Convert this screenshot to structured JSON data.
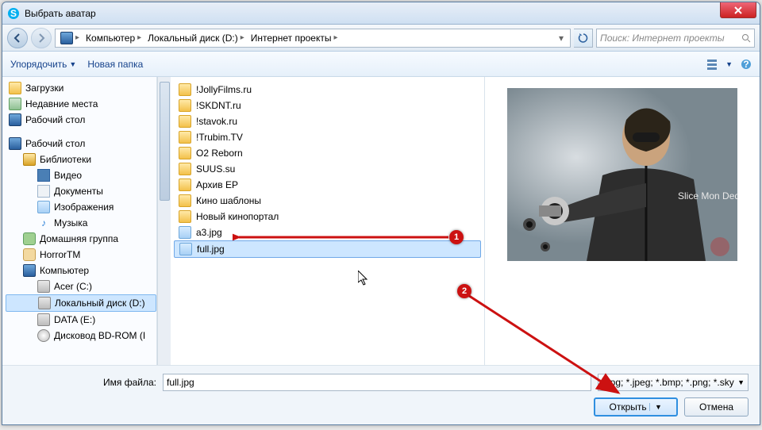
{
  "window": {
    "title": "Выбрать аватар"
  },
  "breadcrumbs": [
    "Компьютер",
    "Локальный диск (D:)",
    "Интернет проекты"
  ],
  "search": {
    "placeholder": "Поиск: Интернет проекты"
  },
  "toolbar": {
    "organize": "Упорядочить",
    "newfolder": "Новая папка"
  },
  "sidebar": {
    "items": [
      {
        "label": "Загрузки",
        "icon": "folder"
      },
      {
        "label": "Недавние места",
        "icon": "recent"
      },
      {
        "label": "Рабочий стол",
        "icon": "monitor"
      },
      {
        "label": "",
        "spacer": true
      },
      {
        "label": "Рабочий стол",
        "icon": "monitor",
        "bold": true
      },
      {
        "label": "Библиотеки",
        "icon": "libraries",
        "indent": 1
      },
      {
        "label": "Видео",
        "icon": "video",
        "indent": 2
      },
      {
        "label": "Документы",
        "icon": "docs",
        "indent": 2
      },
      {
        "label": "Изображения",
        "icon": "images",
        "indent": 2
      },
      {
        "label": "Музыка",
        "icon": "music",
        "indent": 2
      },
      {
        "label": "Домашняя группа",
        "icon": "homegroup",
        "indent": 1
      },
      {
        "label": "HorrorTM",
        "icon": "user",
        "indent": 1
      },
      {
        "label": "Компьютер",
        "icon": "monitor",
        "indent": 1
      },
      {
        "label": "Acer (C:)",
        "icon": "drive",
        "indent": 2
      },
      {
        "label": "Локальный диск (D:)",
        "icon": "drive",
        "indent": 2,
        "selected": true
      },
      {
        "label": "DATA (E:)",
        "icon": "drive",
        "indent": 2
      },
      {
        "label": "Дисковод BD-ROM (I",
        "icon": "disc",
        "indent": 2
      }
    ]
  },
  "files": [
    {
      "label": "!JollyFilms.ru",
      "type": "folder"
    },
    {
      "label": "!SKDNT.ru",
      "type": "folder"
    },
    {
      "label": "!stavok.ru",
      "type": "folder"
    },
    {
      "label": "!Trubim.TV",
      "type": "folder"
    },
    {
      "label": "O2 Reborn",
      "type": "folder"
    },
    {
      "label": "SUUS.su",
      "type": "folder"
    },
    {
      "label": "Архив ЕР",
      "type": "folder"
    },
    {
      "label": "Кино шаблоны",
      "type": "folder"
    },
    {
      "label": "Новый кинопортал",
      "type": "folder"
    },
    {
      "label": "a3.jpg",
      "type": "image"
    },
    {
      "label": "full.jpg",
      "type": "image",
      "selected": true
    }
  ],
  "preview": {
    "overlay_text": "Slice  Mon Deαɢle"
  },
  "footer": {
    "fname_label": "Имя файла:",
    "fname_value": "full.jpg",
    "filter": "*.jpg; *.jpeg; *.bmp; *.png; *.sky",
    "open": "Открыть",
    "cancel": "Отмена"
  },
  "callouts": {
    "1": "1",
    "2": "2"
  }
}
